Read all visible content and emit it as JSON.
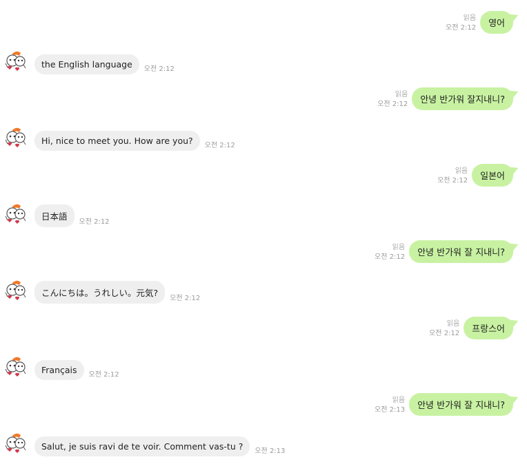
{
  "messages": [
    {
      "dir": "out",
      "read": "읽음",
      "time": "오전 2:12",
      "text": "영어"
    },
    {
      "dir": "in",
      "time": "오전 2:12",
      "text": "the English language"
    },
    {
      "dir": "out",
      "read": "읽음",
      "time": "오전 2:12",
      "text": "안녕 반가워 잘지내니?"
    },
    {
      "dir": "in",
      "time": "오전 2:12",
      "text": "Hi, nice to meet you. How are you?"
    },
    {
      "dir": "out",
      "read": "읽음",
      "time": "오전 2:12",
      "text": "일본어"
    },
    {
      "dir": "in",
      "time": "오전 2:12",
      "text": "日本語"
    },
    {
      "dir": "out",
      "read": "읽음",
      "time": "오전 2:12",
      "text": "안녕 반가워 잘 지내니?"
    },
    {
      "dir": "in",
      "time": "오전 2:12",
      "text": "こんにちは。うれしい。元気?"
    },
    {
      "dir": "out",
      "read": "읽음",
      "time": "오전 2:12",
      "text": "프랑스어"
    },
    {
      "dir": "in",
      "time": "오전 2:12",
      "text": "Français"
    },
    {
      "dir": "out",
      "read": "읽음",
      "time": "오전 2:13",
      "text": "안녕 반가워 잘 지내니?"
    },
    {
      "dir": "in",
      "time": "오전 2:13",
      "text": "Salut, je suis ravi de te voir. Comment vas-tu ?"
    }
  ],
  "colors": {
    "outgoing_bubble": "#c8f2a2",
    "incoming_bubble": "#efefef",
    "meta_text": "#9a9a9a"
  },
  "avatar_icon": "cartoon-character-avatar-icon"
}
